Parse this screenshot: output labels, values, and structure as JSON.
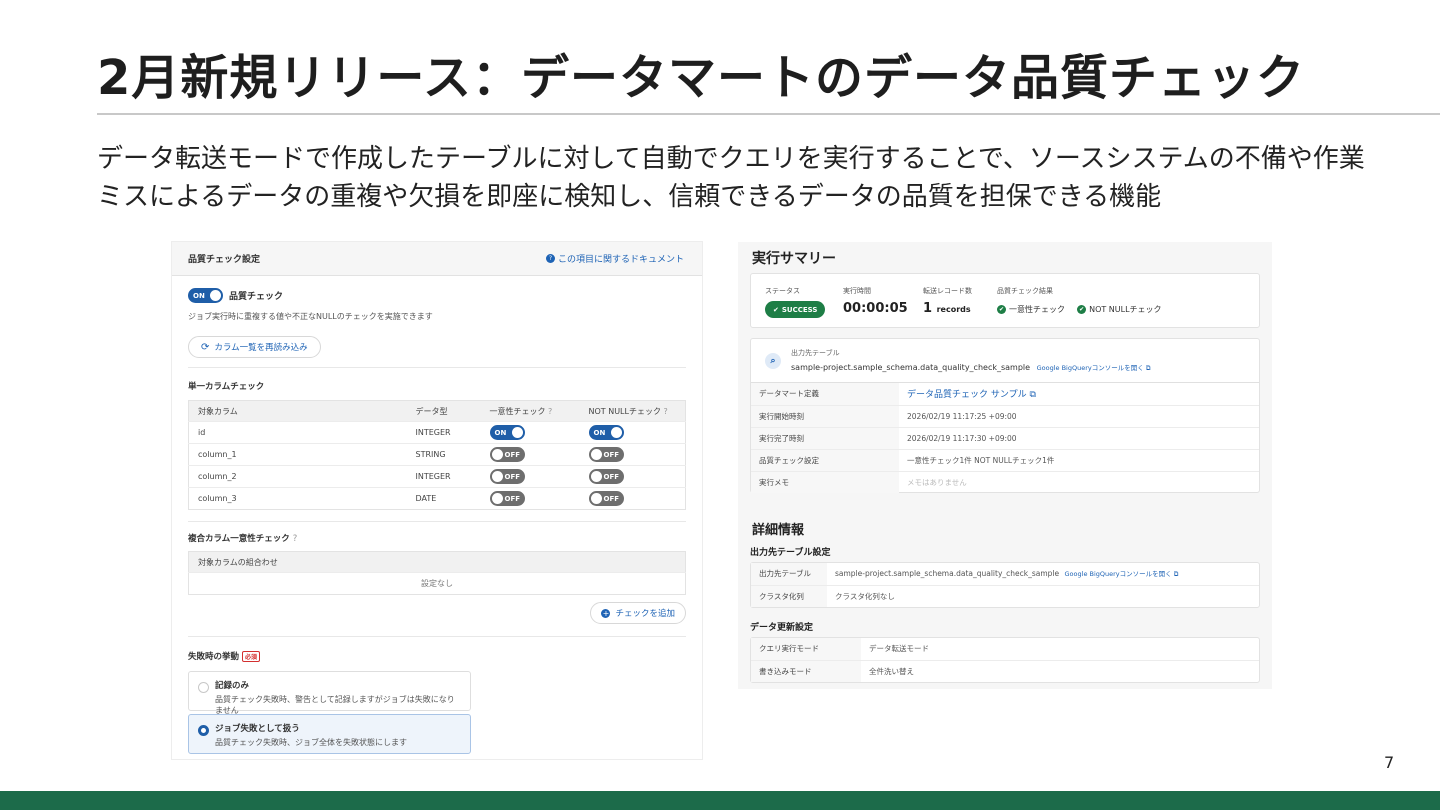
{
  "slide": {
    "title": "2月新規リリース：データマートのデータ品質チェック",
    "description": "データ転送モードで作成したテーブルに対して自動でクエリを実行することで、ソースシステムの不備や作業ミスによるデータの重複や欠損を即座に検知し、信頼できるデータの品質を担保できる機能",
    "page_number": "7",
    "accent_color": "#1c6b4a"
  },
  "left_panel": {
    "header_title": "品質チェック設定",
    "doc_link": "この項目に関するドキュメント",
    "quality_toggle": {
      "state": "ON",
      "label": "品質チェック"
    },
    "toggle_desc": "ジョブ実行時に重複する値や不正なNULLのチェックを実施できます",
    "reload_button": "カラム一覧を再読み込み",
    "single_column_section": "単一カラムチェック",
    "table_headers": [
      "対象カラム",
      "データ型",
      "一意性チェック",
      "NOT NULLチェック"
    ],
    "rows": [
      {
        "column": "id",
        "type": "INTEGER",
        "unique": "ON",
        "not_null": "ON"
      },
      {
        "column": "column_1",
        "type": "STRING",
        "unique": "OFF",
        "not_null": "OFF"
      },
      {
        "column": "column_2",
        "type": "INTEGER",
        "unique": "OFF",
        "not_null": "OFF"
      },
      {
        "column": "column_3",
        "type": "DATE",
        "unique": "OFF",
        "not_null": "OFF"
      }
    ],
    "composite_section": "複合カラム一意性チェック",
    "composite_header": "対象カラムの組合わせ",
    "composite_empty": "設定なし",
    "add_check_button": "チェックを追加",
    "failure_label": "失敗時の挙動",
    "required_badge": "必須",
    "options": [
      {
        "title": "記録のみ",
        "desc": "品質チェック失敗時、警告として記録しますがジョブは失敗になりません",
        "selected": false
      },
      {
        "title": "ジョブ失敗として扱う",
        "desc": "品質チェック失敗時、ジョブ全体を失敗状態にします",
        "selected": true
      }
    ]
  },
  "right_panel": {
    "summary_title": "実行サマリー",
    "status_label": "ステータス",
    "status_value": "SUCCESS",
    "time_label": "実行時間",
    "time_value": "00:00:05",
    "records_label": "転送レコード数",
    "records_value": "1",
    "records_unit": "records",
    "result_label": "品質チェック結果",
    "result_items": [
      "一意性チェック",
      "NOT NULLチェック"
    ],
    "output_table_label": "出力先テーブル",
    "output_table_path": "sample-project.sample_schema.data_quality_check_sample",
    "console_link": "Google BigQueryコンソールを開く",
    "kv_rows": [
      {
        "key": "データマート定義",
        "value": "データ品質チェック サンプル"
      },
      {
        "key": "実行開始時刻",
        "value": "2026/02/19 11:17:25 +09:00"
      },
      {
        "key": "実行完了時刻",
        "value": "2026/02/19 11:17:30 +09:00"
      },
      {
        "key": "品質チェック設定",
        "value": "一意性チェック1件  NOT NULLチェック1件"
      },
      {
        "key": "実行メモ",
        "value": "メモはありません"
      }
    ],
    "details_title": "詳細情報",
    "output_settings_title": "出力先テーブル設定",
    "output_settings": [
      {
        "key": "出力先テーブル",
        "value": "sample-project.sample_schema.data_quality_check_sample"
      },
      {
        "key": "クラスタ化列",
        "value": "クラスタ化列なし"
      }
    ],
    "update_settings_title": "データ更新設定",
    "update_settings": [
      {
        "key": "クエリ実行モード",
        "value": "データ転送モード"
      },
      {
        "key": "書き込みモード",
        "value": "全件洗い替え"
      }
    ]
  }
}
